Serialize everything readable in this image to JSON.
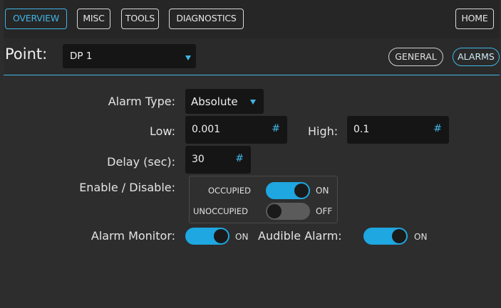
{
  "nav": {
    "overview": "OVERVIEW",
    "misc": "MISC",
    "tools": "TOOLS",
    "diagnostics": "DIAGNOSTICS",
    "home": "HOME",
    "active": "overview"
  },
  "point": {
    "label": "Point:",
    "value": "DP 1"
  },
  "tabs": {
    "general": "GENERAL",
    "alarms": "ALARMS",
    "active": "alarms"
  },
  "form": {
    "alarm_type_label": "Alarm Type:",
    "alarm_type_value": "Absolute",
    "low_label": "Low:",
    "low_value": "0.001",
    "high_label": "High:",
    "high_value": "0.1",
    "delay_label": "Delay (sec):",
    "delay_value": "30",
    "hash_symbol": "#",
    "enable_label": "Enable / Disable:",
    "occupied_label": "OCCUPIED",
    "occupied_state": "ON",
    "unoccupied_label": "UNOCCUPIED",
    "unoccupied_state": "OFF",
    "alarm_monitor_label": "Alarm Monitor:",
    "alarm_monitor_state": "ON",
    "audible_alarm_label": "Audible Alarm:",
    "audible_alarm_state": "ON"
  },
  "colors": {
    "accent": "#41b6e6",
    "toggle_on": "#1ea7e0",
    "toggle_off": "#5b5b5b",
    "background": "#2d2d2d",
    "field_bg": "#151515"
  }
}
